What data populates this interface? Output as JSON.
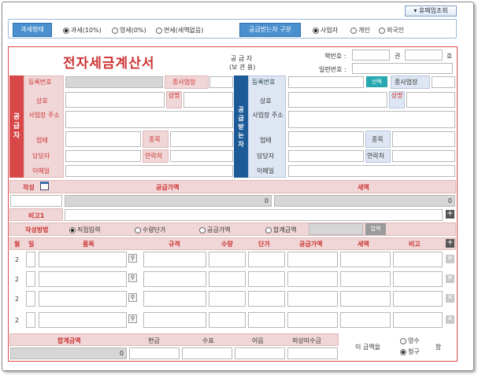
{
  "top_button": "휴폐업조회",
  "type_row": {
    "label": "과세형태",
    "options": [
      "과세(10%)",
      "영세(0%)",
      "면세(세액없음)"
    ],
    "supplied_label": "공급받는자 구분",
    "supplied_options": [
      "사업자",
      "개인",
      "외국인"
    ]
  },
  "doc": {
    "title": "전자세금계산서",
    "subtitle1": "공 급 자",
    "subtitle2": "(보 관 용)",
    "book_no": "책번호 :",
    "vol": "권",
    "ho": "호",
    "serial_no": "일련번호 :"
  },
  "supplier": {
    "side": [
      "공",
      "급",
      "자"
    ],
    "reg_no": "등록번호",
    "branch": "종사업장",
    "company": "상호",
    "name": "성명",
    "address": "사업장 주소",
    "business": "업태",
    "item": "종목",
    "manager": "담당자",
    "contact": "연락처",
    "email": "이메일"
  },
  "receiver": {
    "side": [
      "공",
      "급",
      "받",
      "는",
      "자"
    ],
    "reg_no": "등록번호",
    "select": "선택",
    "branch": "종사업장",
    "company": "상호",
    "name": "성명",
    "address": "사업장 주소",
    "business": "업태",
    "item": "종목",
    "manager": "담당자",
    "contact": "연락처",
    "email": "이메일"
  },
  "summary": {
    "write": "작성",
    "supply": "공급가액",
    "tax": "세액",
    "supply_val": "0",
    "tax_val": "0",
    "note": "비고1"
  },
  "method": {
    "label": "작성방법",
    "options": [
      "직접입력",
      "수량단가",
      "공급가액",
      "합계금액"
    ],
    "input_btn": "입력"
  },
  "items": {
    "headers": [
      "월",
      "일",
      "품목",
      "규격",
      "수량",
      "단가",
      "공급가액",
      "세액",
      "비고"
    ],
    "rows": [
      {
        "month": "2"
      },
      {
        "month": "2"
      },
      {
        "month": "2"
      },
      {
        "month": "2"
      }
    ]
  },
  "totals": {
    "total": "합계금액",
    "cash": "현금",
    "check": "수표",
    "bill": "어음",
    "credit": "외상미수금",
    "total_val": "0",
    "amount_text": "이 금액을",
    "receipt": "영수",
    "claim": "청구",
    "ham": "함"
  }
}
